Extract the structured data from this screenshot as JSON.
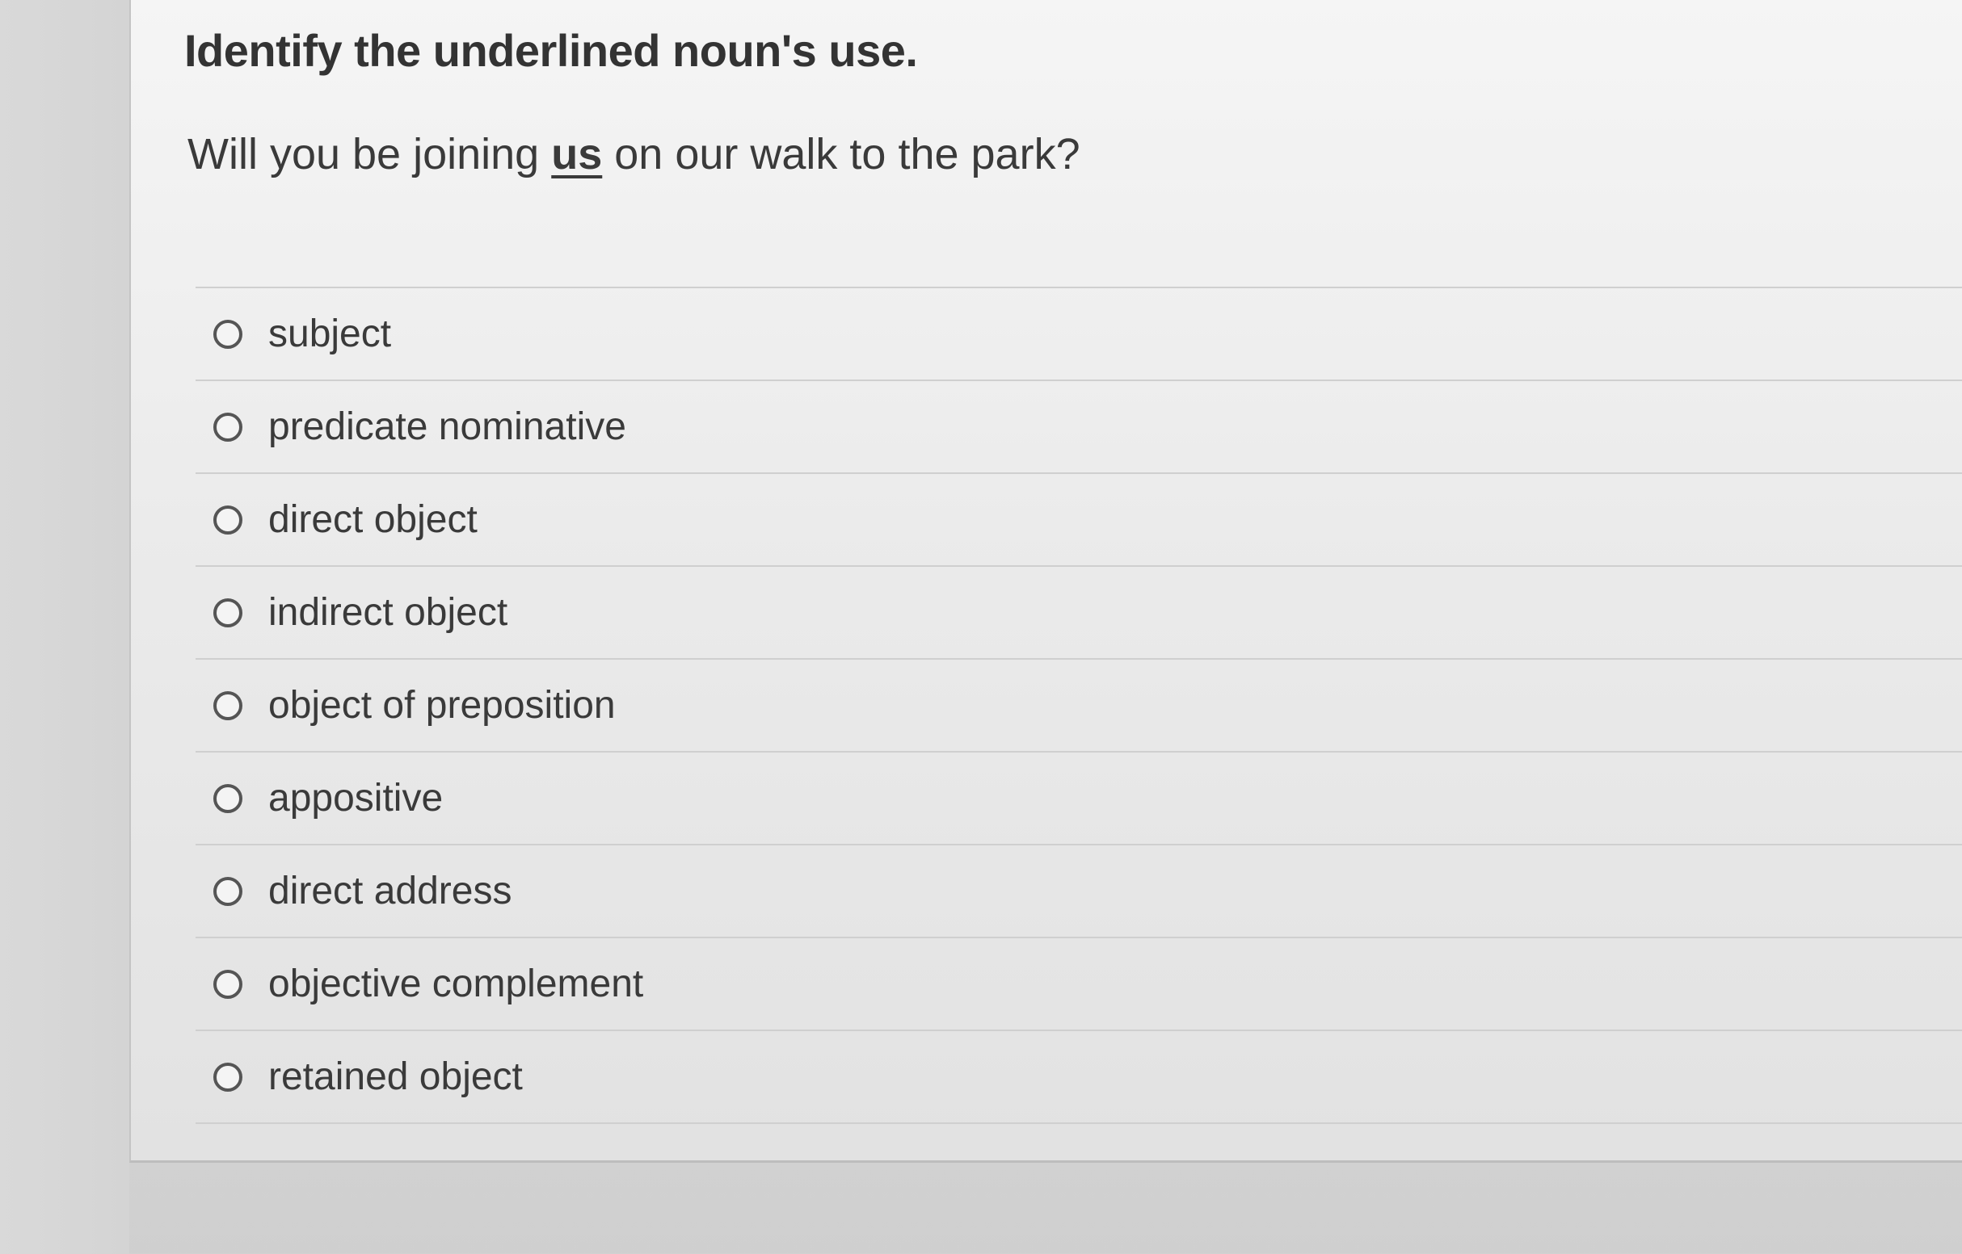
{
  "question": {
    "prompt": "Identify the underlined noun's use.",
    "sentence_before": "Will you be joining ",
    "sentence_target": "us",
    "sentence_after": " on our walk to the park?"
  },
  "options": [
    {
      "label": "subject",
      "selected": false
    },
    {
      "label": "predicate nominative",
      "selected": false
    },
    {
      "label": "direct object",
      "selected": false
    },
    {
      "label": "indirect object",
      "selected": false
    },
    {
      "label": "object of preposition",
      "selected": false
    },
    {
      "label": "appositive",
      "selected": false
    },
    {
      "label": "direct address",
      "selected": false
    },
    {
      "label": "objective complement",
      "selected": false
    },
    {
      "label": "retained object",
      "selected": false
    }
  ]
}
